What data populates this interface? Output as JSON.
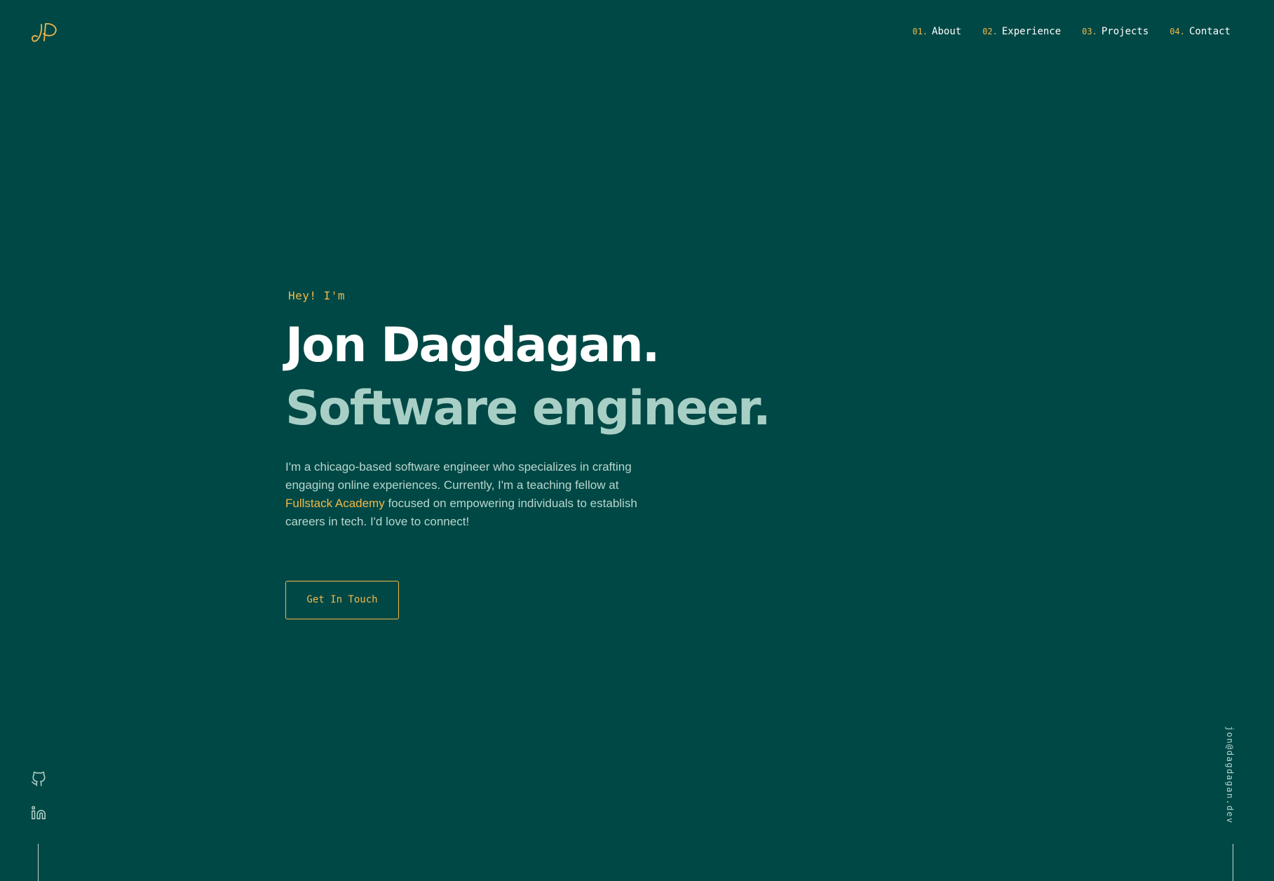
{
  "header": {
    "logo": {
      "icon": "jd-monogram-icon",
      "color": "#f2b84b"
    },
    "nav": [
      {
        "num": "01.",
        "label": "About"
      },
      {
        "num": "02.",
        "label": "Experience"
      },
      {
        "num": "03.",
        "label": "Projects"
      },
      {
        "num": "04.",
        "label": "Contact"
      }
    ]
  },
  "hero": {
    "eyebrow": "Hey! I'm",
    "name": "Jon Dagdagan.",
    "role": "Software engineer.",
    "bio_before": "I'm a chicago-based software engineer who specializes in crafting engaging online experiences. Currently, I'm a teaching fellow at ",
    "bio_link": "Fullstack Academy",
    "bio_after": " focused on empowering individuals to establish careers in tech. I'd love to connect!",
    "cta_label": "Get In Touch"
  },
  "social": [
    {
      "icon": "github-icon"
    },
    {
      "icon": "linkedin-icon"
    }
  ],
  "email": "jon@dagdagan.dev",
  "colors": {
    "background": "#004845",
    "accent": "#f2b84b",
    "muted": "#a8cfc6",
    "text": "#ffffff"
  }
}
